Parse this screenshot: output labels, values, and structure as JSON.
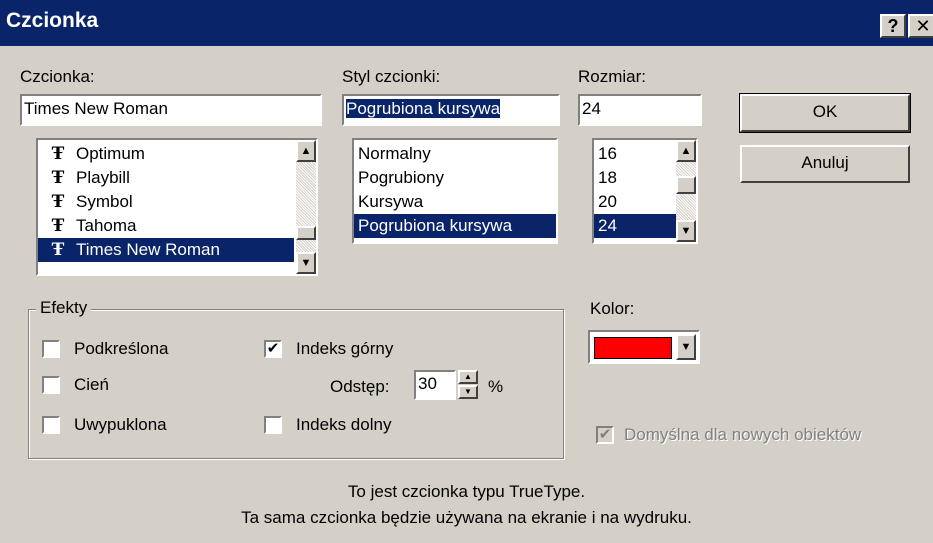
{
  "window": {
    "title": "Czcionka",
    "help_glyph": "?",
    "close_glyph": "✕",
    "help_icon": "help-icon",
    "close_icon": "close-icon"
  },
  "font": {
    "label": "Czcionka:",
    "value": "Times New Roman",
    "items": [
      "Optimum",
      "Playbill",
      "Symbol",
      "Tahoma",
      "Times New Roman"
    ],
    "selected_index": 4,
    "item_icon": "truetype-icon",
    "item_glyph": "Ŧ"
  },
  "style": {
    "label": "Styl czcionki:",
    "value": "Pogrubiona kursywa",
    "items": [
      "Normalny",
      "Pogrubiony",
      "Kursywa",
      "Pogrubiona kursywa"
    ],
    "selected_index": 3
  },
  "size": {
    "label": "Rozmiar:",
    "value": "24",
    "items": [
      "16",
      "18",
      "20",
      "24"
    ],
    "selected_index": 3
  },
  "buttons": {
    "ok": "OK",
    "cancel": "Anuluj"
  },
  "effects": {
    "legend": "Efekty",
    "underline": {
      "label": "Podkreślona",
      "checked": false
    },
    "shadow": {
      "label": "Cień",
      "checked": false
    },
    "emboss": {
      "label": "Uwypuklona",
      "checked": false
    },
    "superscript": {
      "label": "Indeks górny",
      "checked": true
    },
    "subscript": {
      "label": "Indeks dolny",
      "checked": false
    },
    "offset_label": "Odstęp:",
    "offset_value": "30",
    "offset_unit": "%"
  },
  "color": {
    "label": "Kolor:",
    "value": "#ff0000"
  },
  "default_for_new": {
    "label": "Domyślna dla nowych obiektów",
    "checked": true,
    "enabled": false
  },
  "info": {
    "line1": "To jest czcionka typu TrueType.",
    "line2": "Ta sama czcionka będzie używana na ekranie i na wydruku."
  },
  "glyphs": {
    "arrow_up": "▲",
    "arrow_down": "▼",
    "check": "✔"
  }
}
